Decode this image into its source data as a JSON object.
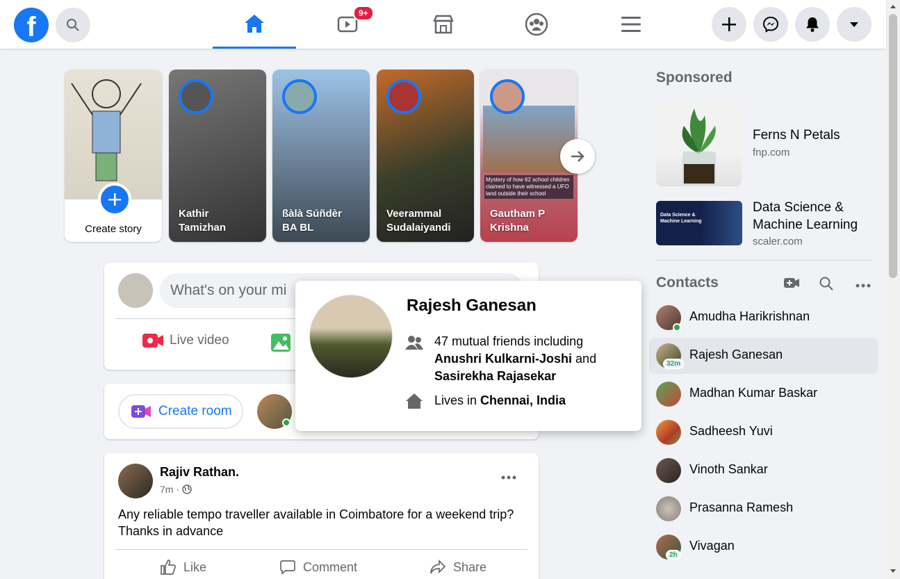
{
  "topbar": {
    "logo_letter": "f",
    "videos_badge": "9+"
  },
  "stories": [
    {
      "name": "Create story"
    },
    {
      "name": "Kathir Tamizhan"
    },
    {
      "name": "ßàlà Súñdèr BA BL"
    },
    {
      "name": "Veerammal Sudalaiyandi"
    },
    {
      "name": "Gautham P Krishna"
    }
  ],
  "story5_news": "Mystery of how 62 school children claimed to have witnessed a UFO land outside their school",
  "composer": {
    "placeholder": "What's on your mind, Nantha?",
    "visible_text": "What's on your mi",
    "live_label": "Live video"
  },
  "rooms": {
    "create_label": "Create room"
  },
  "post": {
    "author": "Rajiv Rathan.",
    "time": "7m",
    "text": "Any reliable tempo traveller available in Coimbatore for a weekend trip? Thanks in advance",
    "like": "Like",
    "comment": "Comment",
    "share": "Share"
  },
  "hovercard": {
    "name": "Rajesh Ganesan",
    "mutual_prefix": "47 mutual friends including",
    "friend1": "Anushri Kulkarni-Joshi",
    "and": "and",
    "friend2": "Sasirekha Rajasekar",
    "lives_prefix": "Lives in",
    "city": "Chennai, India"
  },
  "sponsored": {
    "heading": "Sponsored",
    "ads": [
      {
        "title": "Ferns N Petals",
        "domain": "fnp.com"
      },
      {
        "title": "Data Science & Machine Learning",
        "domain": "scaler.com",
        "thumb_text": "Data Science & Machine Learning"
      }
    ]
  },
  "contacts": {
    "heading": "Contacts",
    "items": [
      {
        "name": "Amudha Harikrishnan",
        "online": true
      },
      {
        "name": "Rajesh Ganesan",
        "time": "32m"
      },
      {
        "name": "Madhan Kumar Baskar"
      },
      {
        "name": "Sadheesh Yuvi"
      },
      {
        "name": "Vinoth Sankar"
      },
      {
        "name": "Prasanna Ramesh"
      },
      {
        "name": "Vivagan",
        "time": "2h"
      }
    ]
  },
  "colors": {
    "brand": "#1877f2",
    "bg": "#f0f2f5",
    "badge": "#e41e3f",
    "online": "#31a24c"
  }
}
